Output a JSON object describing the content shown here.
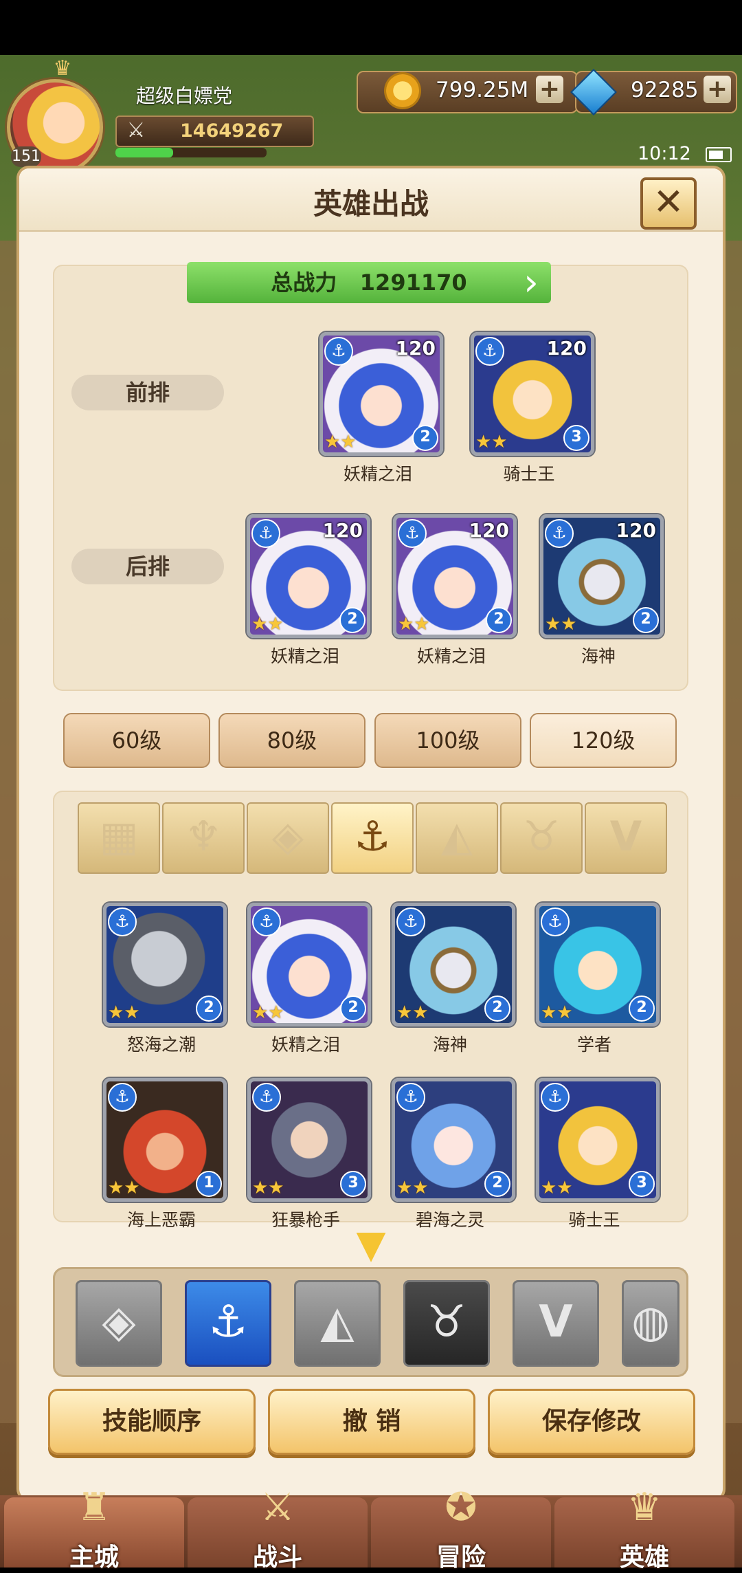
{
  "player": {
    "name": "超级白嫖党",
    "level": "151",
    "power": "14649267",
    "xp_fraction": 0.38
  },
  "resources": {
    "gold": "799.25M",
    "gems": "92285",
    "plus": "+"
  },
  "status": {
    "time": "10:12"
  },
  "panel": {
    "title": "英雄出战",
    "close": "✕",
    "total_power_label": "总战力",
    "total_power": "1291170"
  },
  "formation": {
    "front_label": "前排",
    "back_label": "后排",
    "front": [
      {
        "name": "妖精之泪",
        "level": "120",
        "rank": "2",
        "portrait": "p-fairy"
      },
      {
        "name": "骑士王",
        "level": "120",
        "rank": "3",
        "portrait": "p-knight-king"
      }
    ],
    "back": [
      {
        "name": "妖精之泪",
        "level": "120",
        "rank": "2",
        "portrait": "p-fairy"
      },
      {
        "name": "妖精之泪",
        "level": "120",
        "rank": "2",
        "portrait": "p-fairy"
      },
      {
        "name": "海神",
        "level": "120",
        "rank": "2",
        "portrait": "p-sea-god"
      }
    ]
  },
  "level_tabs": [
    "60级",
    "80级",
    "100级",
    "120级"
  ],
  "active_level_tab": 3,
  "faction_tabs": [
    {
      "icon": "grid-icon",
      "glyph": "▦"
    },
    {
      "icon": "flame-icon",
      "glyph": "♆"
    },
    {
      "icon": "diamond-icon",
      "glyph": "◈"
    },
    {
      "icon": "anchor-icon",
      "glyph": "⚓"
    },
    {
      "icon": "beast-icon",
      "glyph": "◭"
    },
    {
      "icon": "horn-icon",
      "glyph": "♉"
    },
    {
      "icon": "wing-icon",
      "glyph": "V"
    }
  ],
  "active_faction_tab": 3,
  "roster": [
    {
      "name": "怒海之潮",
      "rank": "2",
      "portrait": "p-knight"
    },
    {
      "name": "妖精之泪",
      "rank": "2",
      "portrait": "p-fairy"
    },
    {
      "name": "海神",
      "rank": "2",
      "portrait": "p-sea-god"
    },
    {
      "name": "学者",
      "rank": "2",
      "portrait": "p-scholar"
    },
    {
      "name": "海上恶霸",
      "rank": "1",
      "portrait": "p-pirate"
    },
    {
      "name": "狂暴枪手",
      "rank": "3",
      "portrait": "p-gunner"
    },
    {
      "name": "碧海之灵",
      "rank": "2",
      "portrait": "p-sea-spirit"
    },
    {
      "name": "骑士王",
      "rank": "3",
      "portrait": "p-knight-king"
    }
  ],
  "element_slots": [
    {
      "icon": "diamond-icon",
      "glyph": "◈",
      "style": "gray"
    },
    {
      "icon": "anchor-icon",
      "glyph": "⚓",
      "style": "active"
    },
    {
      "icon": "beast-icon",
      "glyph": "◭",
      "style": "gray"
    },
    {
      "icon": "horn-icon",
      "glyph": "♉",
      "style": "dark"
    },
    {
      "icon": "wing-icon",
      "glyph": "V",
      "style": "gray"
    },
    {
      "icon": "stone-icon",
      "glyph": "◍",
      "style": "gray"
    }
  ],
  "actions": {
    "skill_order": "技能顺序",
    "undo": "撤 销",
    "save": "保存修改"
  },
  "nav": [
    {
      "label": "主城",
      "icon": "castle-icon",
      "glyph": "♜"
    },
    {
      "label": "战斗",
      "icon": "swords-icon",
      "glyph": "⚔"
    },
    {
      "label": "冒险",
      "icon": "map-icon",
      "glyph": "✪"
    },
    {
      "label": "英雄",
      "icon": "hero-icon",
      "glyph": "♛"
    }
  ],
  "active_nav": 0
}
